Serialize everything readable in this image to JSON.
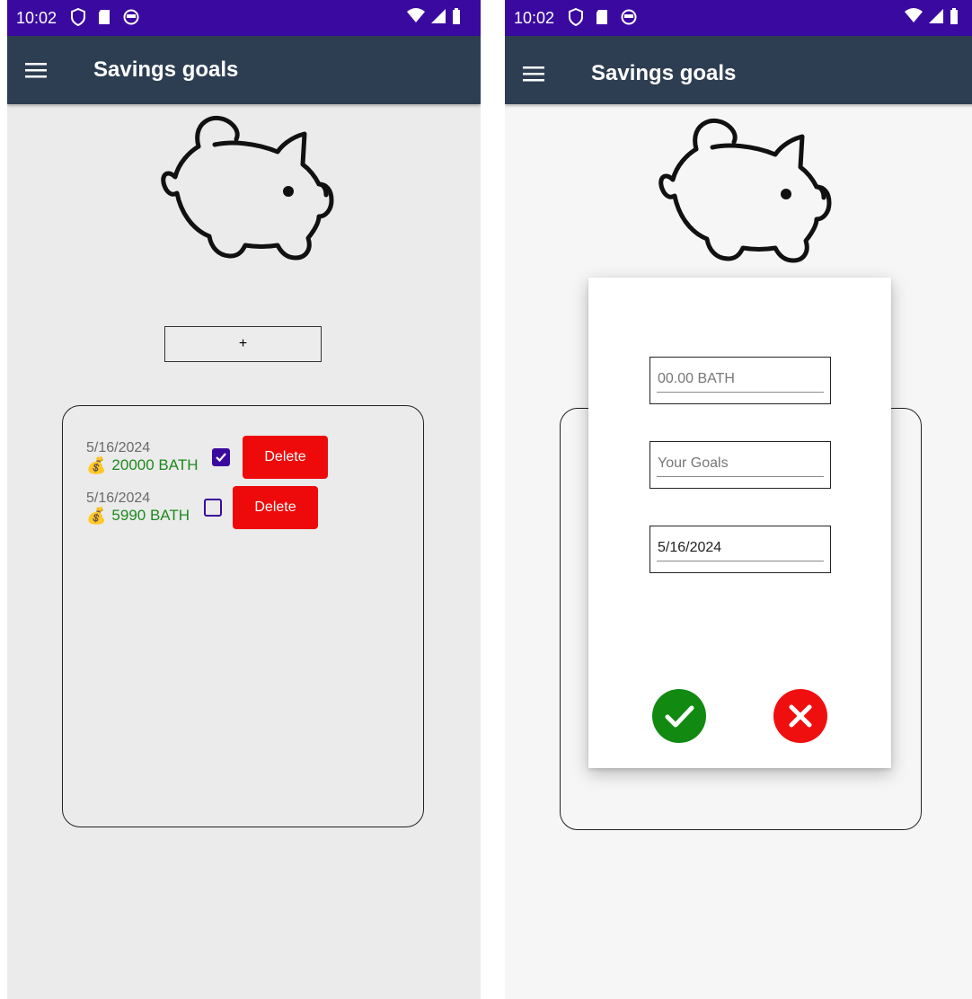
{
  "status_bar": {
    "time": "10:02"
  },
  "app_bar": {
    "title": "Savings goals"
  },
  "icons": {
    "menu": "hamburger-menu-icon",
    "logo": "piggy-bank-icon",
    "money": "money-bag-icon",
    "confirm": "checkmark-icon",
    "cancel": "close-x-icon"
  },
  "colors": {
    "status_bar": "#3a0aa0",
    "app_bar": "#2e3e52",
    "delete": "#ee0a0a",
    "amount_text": "#1d8a1d",
    "checkbox": "#3a0aa0",
    "confirm": "#128a12",
    "cancel": "#f00f0f"
  },
  "left_screen": {
    "add_button_label": "+",
    "goals": [
      {
        "date": "5/16/2024",
        "amount": "20000 BATH",
        "checked": true,
        "delete_label": "Delete"
      },
      {
        "date": "5/16/2024",
        "amount": "5990 BATH",
        "checked": false,
        "delete_label": "Delete"
      }
    ]
  },
  "right_screen": {
    "dialog": {
      "amount_placeholder": "00.00 BATH",
      "goal_placeholder": "Your Goals",
      "date_value": "5/16/2024"
    }
  }
}
